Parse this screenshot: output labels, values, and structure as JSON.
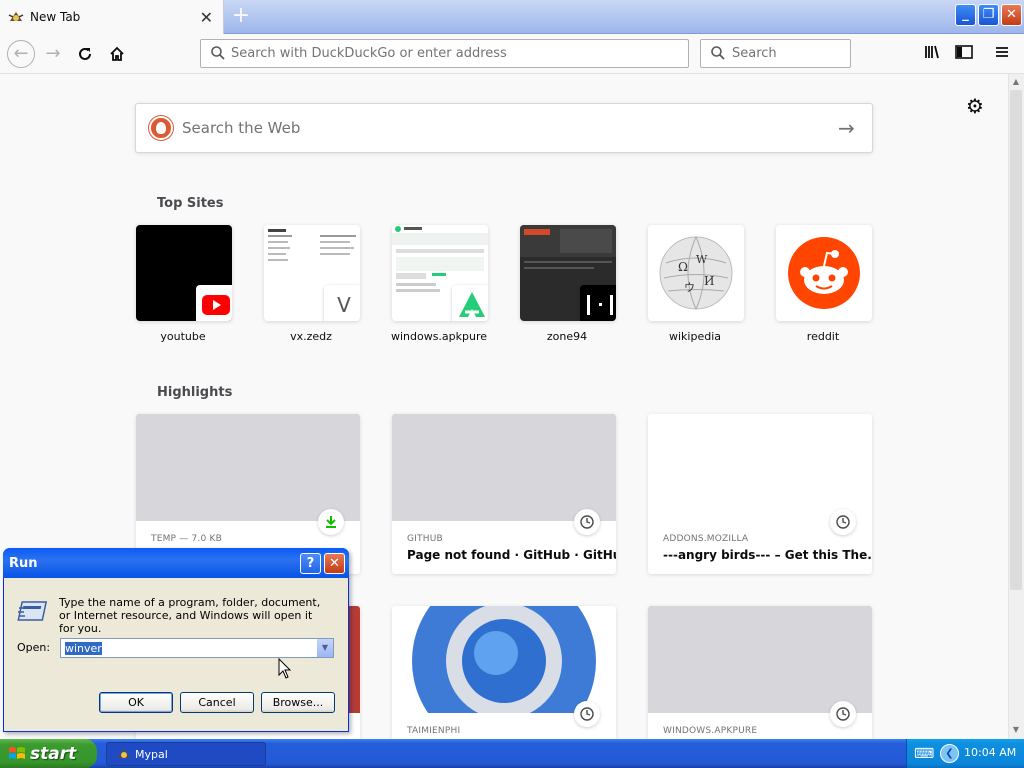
{
  "browser": {
    "tab_title": "New Tab",
    "new_tab_symbol": "+",
    "url_placeholder": "Search with DuckDuckGo or enter address",
    "search_placeholder": "Search",
    "window_controls": {
      "minimize": "_",
      "maximize": "❐",
      "close": "✕"
    }
  },
  "newtab": {
    "web_search_placeholder": "Search the Web",
    "top_sites_title": "Top Sites",
    "top_sites": [
      {
        "label": "youtube"
      },
      {
        "label": "vx.zedz",
        "badge_letter": "V"
      },
      {
        "label": "windows.apkpure"
      },
      {
        "label": "zone94"
      },
      {
        "label": "wikipedia"
      },
      {
        "label": "reddit"
      }
    ],
    "highlights_title": "Highlights",
    "highlights": [
      {
        "source": "TEMP — 7.0 KB",
        "title": ""
      },
      {
        "source": "GITHUB",
        "title": "Page not found · GitHub · GitHub"
      },
      {
        "source": "ADDONS.MOZILLA",
        "title": "---angry birds--- – Get this The..."
      },
      {
        "source": "",
        "title": ""
      },
      {
        "source": "TAIMIENPHI",
        "title": ""
      },
      {
        "source": "WINDOWS.APKPURE",
        "title": ""
      }
    ],
    "gear_icon": "gear-icon"
  },
  "run_dialog": {
    "title": "Run",
    "help_label": "?",
    "close_label": "✕",
    "description": "Type the name of a program, folder, document, or Internet resource, and Windows will open it for you.",
    "open_label": "Open:",
    "input_value": "winver",
    "ok_label": "OK",
    "cancel_label": "Cancel",
    "browse_label": "Browse..."
  },
  "taskbar": {
    "start_label": "start",
    "task_label": "Mypal",
    "clock": "10:04 AM"
  },
  "colors": {
    "reddit": "#ff4500",
    "youtube": "#ff0000",
    "apkpure": "#24cd77",
    "ddg": "#de5833",
    "xp_blue": "#0a5cf6"
  }
}
